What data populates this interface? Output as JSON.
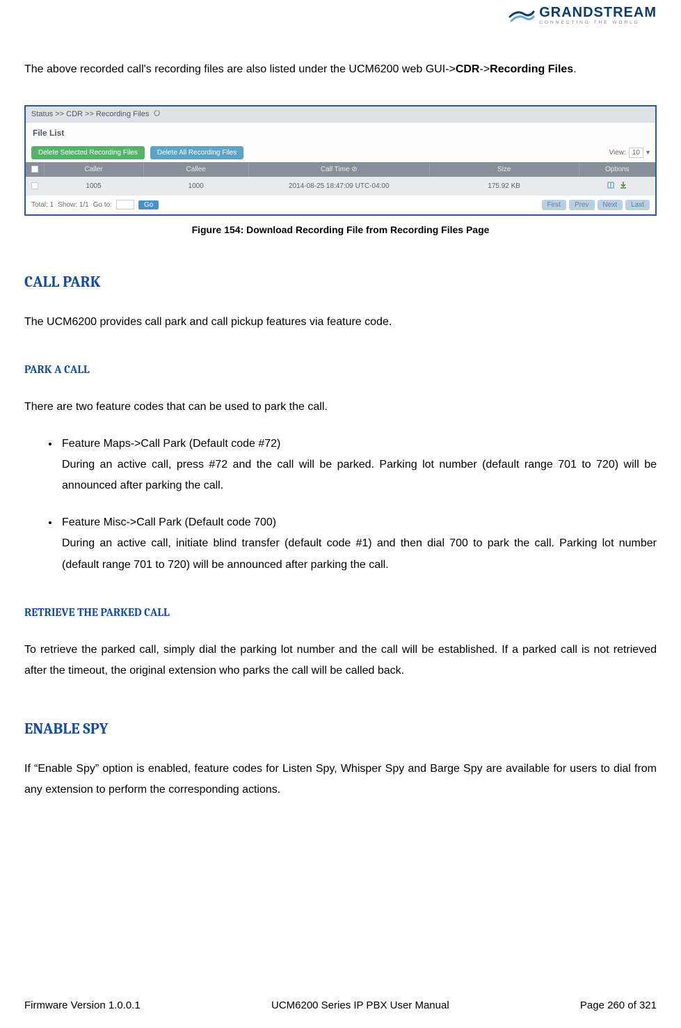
{
  "logo": {
    "brand": "GRANDSTREAM",
    "tagline": "CONNECTING THE WORLD"
  },
  "intro": {
    "pre": "The above recorded call's recording files are also listed under the UCM6200 web GUI->",
    "bold1": "CDR",
    "sep": "->",
    "bold2": "Recording Files",
    "post": "."
  },
  "figure": {
    "breadcrumb": "Status >> CDR >> Recording Files",
    "file_list_label": "File List",
    "btn_delete_selected": "Delete Selected Recording Files",
    "btn_delete_all": "Delete All Recording Files",
    "view_label": "View:",
    "view_value": "10",
    "headers": {
      "caller": "Caller",
      "callee": "Callee",
      "calltime": "Call Time ⊘",
      "size": "Size",
      "options": "Options"
    },
    "row": {
      "caller": "1005",
      "callee": "1000",
      "calltime": "2014-08-25 18:47:09 UTC-04:00",
      "size": "175.92 KB"
    },
    "footer": {
      "total": "Total: 1",
      "show": "Show: 1/1",
      "goto": "Go to:",
      "go": "Go",
      "first": "First",
      "prev": "Prev",
      "next": "Next",
      "last": "Last"
    },
    "caption": "Figure 154: Download Recording File from Recording Files Page"
  },
  "sections": {
    "call_park": {
      "title": "CALL PARK",
      "intro": "The UCM6200 provides call park and call pickup features via feature code."
    },
    "park_a_call": {
      "title": "PARK A CALL",
      "intro": "There are two feature codes that can be used to park the call.",
      "items": [
        {
          "head": "Feature Maps->Call Park (Default code #72)",
          "body": "During an active call, press #72 and the call will be parked. Parking lot number (default range 701 to 720) will be announced after parking the call."
        },
        {
          "head": "Feature Misc->Call Park (Default code 700)",
          "body": "During an active call, initiate blind transfer (default code #1) and then dial 700 to park the call. Parking lot number (default range 701 to 720) will be announced after parking the call."
        }
      ]
    },
    "retrieve": {
      "title": "RETRIEVE THE PARKED CALL",
      "body": "To retrieve the parked call, simply dial the parking lot number and the call will be established. If a parked call is not retrieved after the timeout, the original extension who parks the call will be called back."
    },
    "enable_spy": {
      "title": "ENABLE SPY",
      "body": "If “Enable Spy” option is enabled, feature codes for Listen Spy, Whisper Spy and Barge Spy are available for users to dial from any extension to perform the corresponding actions."
    }
  },
  "footer": {
    "left": "Firmware Version 1.0.0.1",
    "center": "UCM6200 Series IP PBX User Manual",
    "right": "Page 260 of 321"
  }
}
